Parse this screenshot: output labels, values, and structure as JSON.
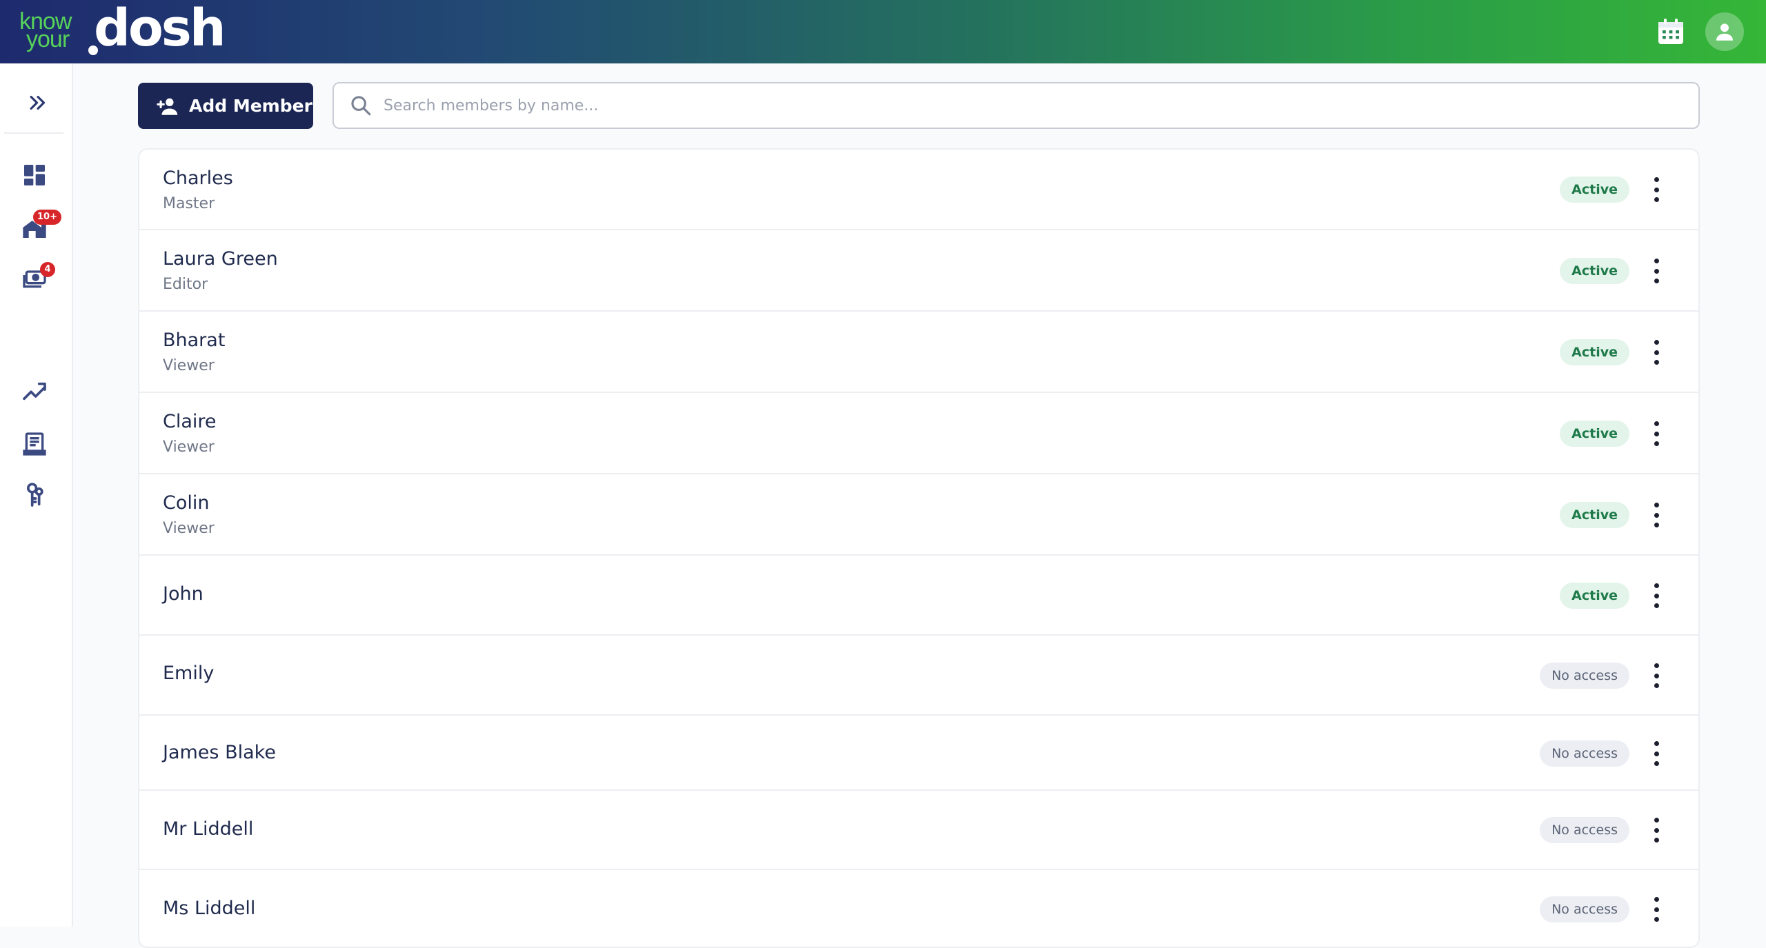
{
  "header": {
    "logo": {
      "small_top": "know",
      "small_bottom": "your",
      "big": "dosh"
    },
    "gradient_colors": [
      "#1e2a6e",
      "#24715e",
      "#35b637"
    ],
    "icons": [
      "calendar-icon",
      "account-icon"
    ]
  },
  "sidebar": {
    "toggle_icon": "chevron-double-right-icon",
    "items": [
      {
        "icon": "dashboard-icon",
        "badge": ""
      },
      {
        "icon": "properties-icon",
        "badge": "10+"
      },
      {
        "icon": "payments-icon",
        "badge": "4"
      },
      {
        "icon": "analytics-icon",
        "badge": ""
      },
      {
        "icon": "documents-icon",
        "badge": ""
      },
      {
        "icon": "keys-icon",
        "badge": ""
      }
    ],
    "badge_color": "#d7262a"
  },
  "toolbar": {
    "add_member_label": "Add Member",
    "search_placeholder": "Search members by name..."
  },
  "members": [
    {
      "name": "Charles",
      "role": "Master",
      "status": "Active"
    },
    {
      "name": "Laura Green",
      "role": "Editor",
      "status": "Active"
    },
    {
      "name": "Bharat",
      "role": "Viewer",
      "status": "Active"
    },
    {
      "name": "Claire",
      "role": "Viewer",
      "status": "Active"
    },
    {
      "name": "Colin",
      "role": "Viewer",
      "status": "Active"
    },
    {
      "name": "John",
      "role": "",
      "status": "Active"
    },
    {
      "name": "Emily",
      "role": "",
      "status": "No access"
    },
    {
      "name": "James Blake",
      "role": "",
      "status": "No access"
    },
    {
      "name": "Mr Liddell",
      "role": "",
      "status": "No access"
    },
    {
      "name": "Ms Liddell",
      "role": "",
      "status": "No access"
    }
  ],
  "colors": {
    "primary": "#1b2654",
    "active_bg": "#e3f4ea",
    "active_text": "#1f7a4a",
    "noaccess_bg": "#eceef3"
  }
}
